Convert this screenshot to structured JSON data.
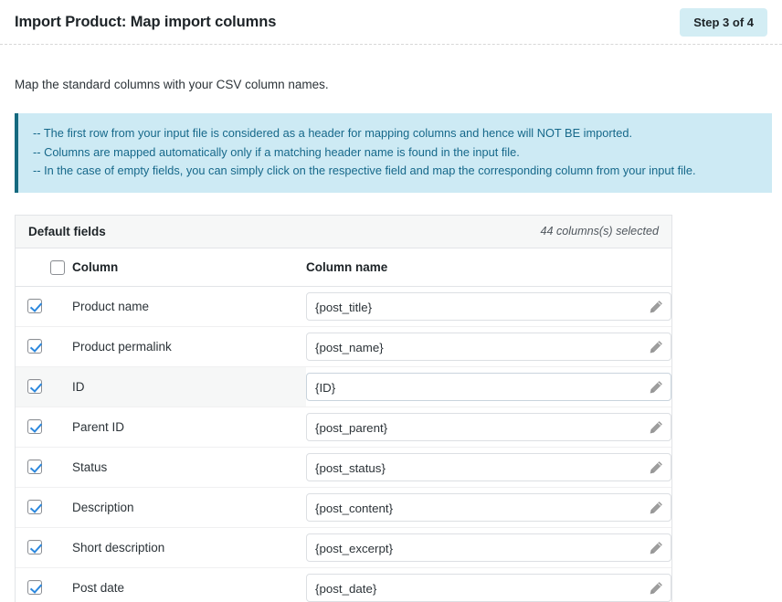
{
  "header": {
    "title": "Import Product: Map import columns",
    "step_badge": "Step 3 of 4"
  },
  "intro": "Map the standard columns with your CSV column names.",
  "notice": {
    "lines": [
      "-- The first row from your input file is considered as a header for mapping columns and hence will NOT BE imported.",
      "-- Columns are mapped automatically only if a matching header name is found in the input file.",
      "-- In the case of empty fields, you can simply click on the respective field and map the corresponding column from your input file."
    ]
  },
  "panel": {
    "title": "Default fields",
    "selected_meta": "44 columns(s) selected",
    "columns": {
      "column": "Column",
      "column_name": "Column name"
    },
    "select_all_checked": false,
    "rows": [
      {
        "label": "Product name",
        "value": "{post_title}",
        "checked": true,
        "hover": false
      },
      {
        "label": "Product permalink",
        "value": "{post_name}",
        "checked": true,
        "hover": false
      },
      {
        "label": "ID",
        "value": "{ID}",
        "checked": true,
        "hover": true
      },
      {
        "label": "Parent ID",
        "value": "{post_parent}",
        "checked": true,
        "hover": false
      },
      {
        "label": "Status",
        "value": "{post_status}",
        "checked": true,
        "hover": false
      },
      {
        "label": "Description",
        "value": "{post_content}",
        "checked": true,
        "hover": false
      },
      {
        "label": "Short description",
        "value": "{post_excerpt}",
        "checked": true,
        "hover": false
      },
      {
        "label": "Post date",
        "value": "{post_date}",
        "checked": true,
        "hover": false
      }
    ]
  },
  "icons": {
    "edit": "pencil-icon",
    "checkbox": "checkbox-icon"
  },
  "colors": {
    "notice_bg": "#cdeaf4",
    "notice_border": "#15697f",
    "notice_text": "#16688a",
    "badge_bg": "#d3edf4",
    "check_blue": "#2b87dd",
    "panel_head_bg": "#f6f7f7"
  }
}
